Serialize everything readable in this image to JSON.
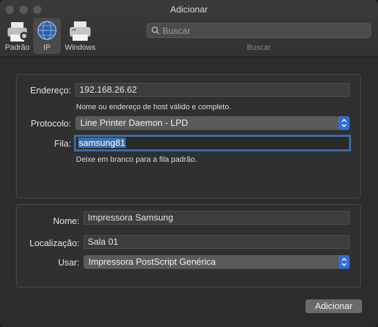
{
  "window": {
    "title": "Adicionar"
  },
  "toolbar": {
    "items": [
      {
        "label": "Padrão",
        "icon": "default-printer-icon"
      },
      {
        "label": "IP",
        "icon": "ip-globe-icon",
        "selected": true
      },
      {
        "label": "Windows",
        "icon": "windows-printer-icon"
      }
    ],
    "search": {
      "placeholder": "Buscar",
      "caption": "Buscar"
    }
  },
  "form": {
    "address": {
      "label": "Endereço:",
      "value": "192.168.26.62",
      "hint": "Nome ou endereço de host válido e completo."
    },
    "protocol": {
      "label": "Protocolo:",
      "value": "Line Printer Daemon - LPD"
    },
    "queue": {
      "label": "Fila:",
      "value": "samsung81",
      "hint": "Deixe em branco para a fila padrão."
    },
    "name": {
      "label": "Nome:",
      "value": "Impressora Samsung"
    },
    "location": {
      "label": "Localização:",
      "value": "Sala 01"
    },
    "use": {
      "label": "Usar:",
      "value": "Impressora PostScript Genérica"
    }
  },
  "actions": {
    "add_label": "Adicionar"
  },
  "colors": {
    "accent": "#3b6ea8",
    "popup_arrow": "#2f6fd6"
  }
}
